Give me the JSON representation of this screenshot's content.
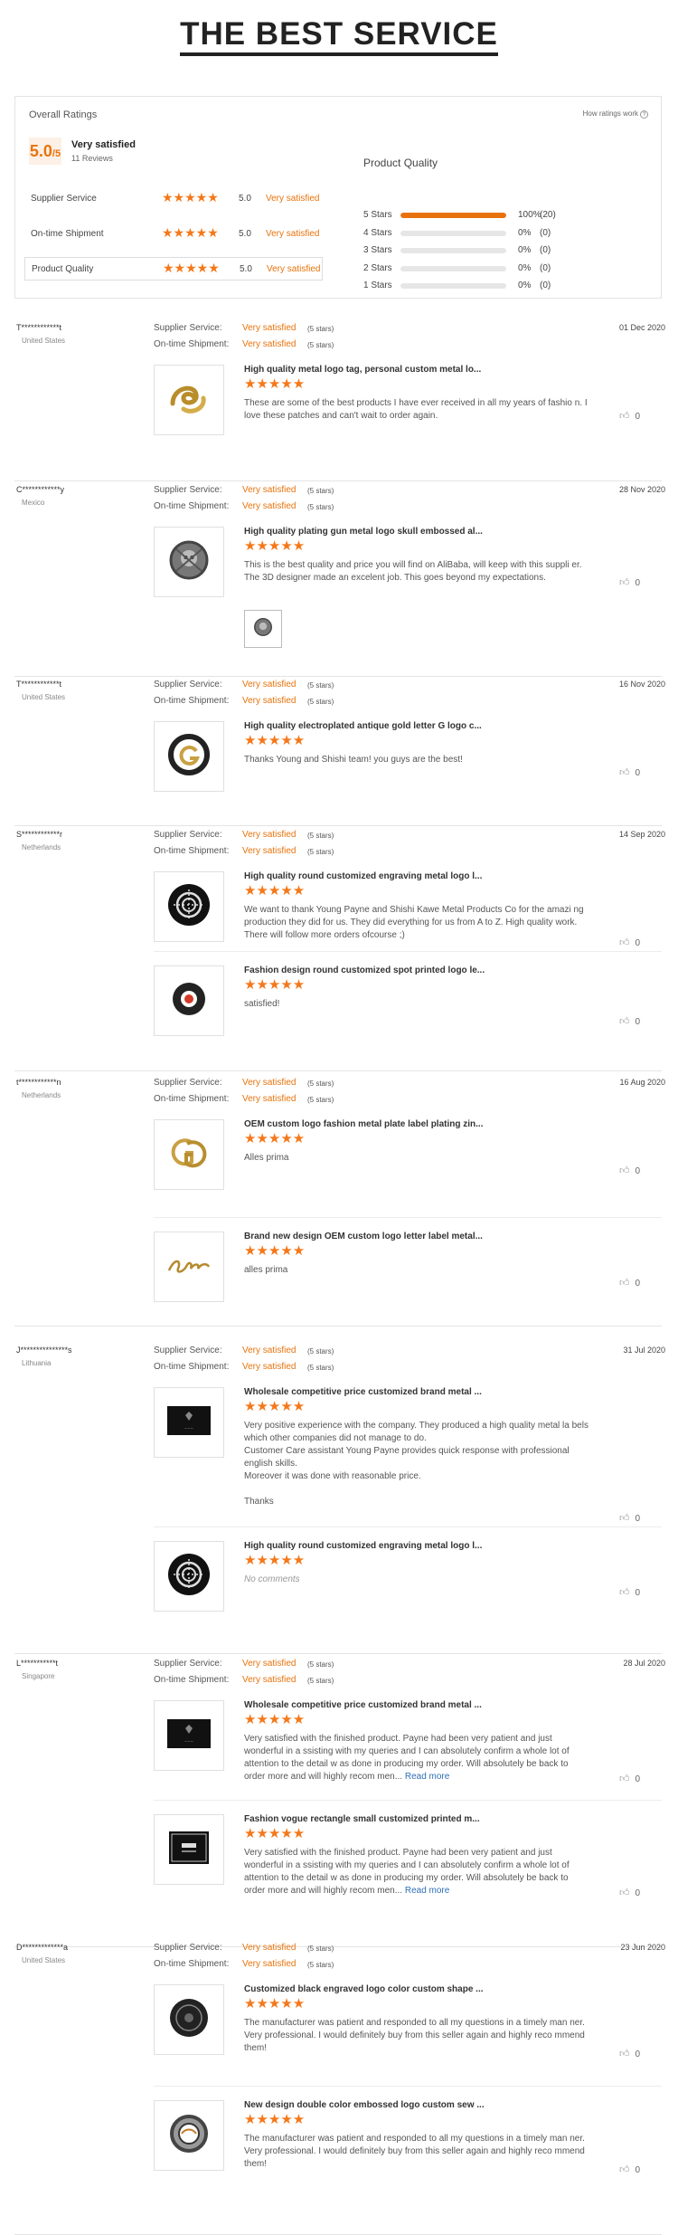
{
  "header": {
    "title": "THE BEST SERVICE"
  },
  "overall": {
    "title": "Overall Ratings",
    "how_link": "How ratings work",
    "help_icon": "?",
    "score": "5.0",
    "score_suffix": "/5",
    "summary": "Very satisfied",
    "reviews_count": "11 Reviews",
    "categories": [
      {
        "label": "Supplier Service",
        "stars": "★★★★★",
        "value": "5.0",
        "text": "Very satisfied"
      },
      {
        "label": "On-time Shipment",
        "stars": "★★★★★",
        "value": "5.0",
        "text": "Very satisfied"
      },
      {
        "label": "Product Quality",
        "stars": "★★★★★",
        "value": "5.0",
        "text": "Very satisfied"
      }
    ],
    "product_quality": {
      "title": "Product Quality",
      "rows": [
        {
          "label": "5 Stars",
          "fraction": 1.0,
          "pct": "100%",
          "count": "(20)"
        },
        {
          "label": "4 Stars",
          "fraction": 0,
          "pct": "0%",
          "count": "(0)"
        },
        {
          "label": "3 Stars",
          "fraction": 0,
          "pct": "0%",
          "count": "(0)"
        },
        {
          "label": "2 Stars",
          "fraction": 0,
          "pct": "0%",
          "count": "(0)"
        },
        {
          "label": "1 Stars",
          "fraction": 0,
          "pct": "0%",
          "count": "(0)"
        }
      ]
    }
  },
  "labels": {
    "supplier": "Supplier Service:",
    "shipment": "On-time Shipment:",
    "value": "Very satisfied",
    "stars5": "(5 stars)",
    "stars": "★★★★★",
    "like_count": "0",
    "read_more": "Read more"
  },
  "reviews": [
    {
      "name": "T************t",
      "country": "United States",
      "date": "01 Dec 2020",
      "products": [
        {
          "title": "High quality metal logo tag, personal custom metal lo...",
          "body": "These are some of the best products I have ever received in all my years of fashio n. I love these patches and can't wait to order again.",
          "icon": "gold-swirl-logo"
        }
      ]
    },
    {
      "name": "C************y",
      "country": "Mexico",
      "date": "28 Nov 2020",
      "products": [
        {
          "title": "High quality plating gun metal logo skull embossed al...",
          "body": "This is the best quality and price you will find on AliBaba, will keep with this suppli er. The 3D designer made an excelent job. This goes beyond my expectations.",
          "icon": "skull-badge"
        }
      ]
    },
    {
      "name": "T************t",
      "country": "United States",
      "date": "16 Nov 2020",
      "products": [
        {
          "title": "High quality electroplated antique gold letter G logo c...",
          "body": "Thanks Young and Shishi team! you guys are the best!",
          "icon": "g-logo"
        }
      ]
    },
    {
      "name": "S************r",
      "country": "Netherlands",
      "date": "14 Sep 2020",
      "products": [
        {
          "title": "High quality round customized engraving metal logo l...",
          "body": "We want to thank Young Payne and Shishi Kawe Metal Products Co for the amazi ng production they did for us. They did everything for us from A to Z. High quality work. There will follow more orders ofcourse ;)",
          "icon": "round-engraved-logo"
        },
        {
          "title": "Fashion design round customized spot printed logo le...",
          "body": "satisfied!",
          "icon": "round-printed-logo"
        }
      ]
    },
    {
      "name": "t************n",
      "country": "Netherlands",
      "date": "16 Aug 2020",
      "products": [
        {
          "title": "OEM custom logo fashion metal plate label plating zin...",
          "body": "Alles prima",
          "icon": "gg-logo"
        },
        {
          "title": "Brand new design OEM custom logo letter label metal...",
          "body": "alles prima",
          "icon": "script-logo"
        }
      ]
    },
    {
      "name": "J***************s",
      "country": "Lithuania",
      "date": "31 Jul 2020",
      "products": [
        {
          "title": "Wholesale competitive price customized brand metal ...",
          "body": "Very positive experience with the company. They produced a high quality metal la bels which other companies did not manage to do.\nCustomer Care assistant Young Payne provides quick response with professional english skills.\nMoreover it was done with reasonable price.\n\nThanks",
          "icon": "black-label"
        },
        {
          "title": "High quality round customized engraving metal logo l...",
          "body": "No comments",
          "icon": "round-engraved-logo"
        }
      ]
    },
    {
      "name": "L***********t",
      "country": "Singapore",
      "date": "28 Jul 2020",
      "products": [
        {
          "title": "Wholesale competitive price customized brand metal ...",
          "body": "Very satisfied with the finished product. Payne had been very patient and just wonderful in a ssisting with my queries and I can absolutely confirm a whole lot of attention to the detail w as done in producing my order. Will absolutely be back to order more and will highly recom men...",
          "icon": "black-label"
        },
        {
          "title": "Fashion vogue rectangle small customized printed m...",
          "body": "Very satisfied with the finished product. Payne had been very patient and just wonderful in a ssisting with my queries and I can absolutely confirm a whole lot of attention to the detail w as done in producing my order. Will absolutely be back to order more and will highly recom men...",
          "icon": "vogue-label"
        }
      ]
    },
    {
      "name": "D*************a",
      "country": "United States",
      "date": "23 Jun 2020",
      "products": [
        {
          "title": "Customized black engraved logo color custom shape ...",
          "body": "The manufacturer was patient and responded to all my questions in a timely man ner. Very professional. I would definitely buy from this seller again and highly reco mmend them!",
          "icon": "black-button-logo"
        },
        {
          "title": "New design double color embossed logo custom sew ...",
          "body": "The manufacturer was patient and responded to all my questions in a timely man ner. Very professional. I would definitely buy from this seller again and highly reco mmend them!",
          "icon": "sew-button-logo"
        }
      ]
    }
  ]
}
